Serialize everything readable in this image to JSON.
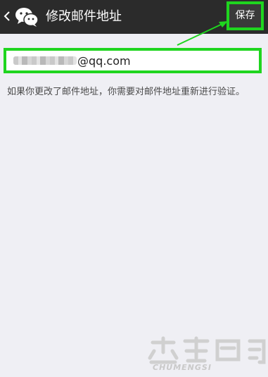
{
  "header": {
    "back_icon": "chevron-left-icon",
    "app_icon": "wechat-icon",
    "title": "修改邮件地址",
    "save_label": "保存"
  },
  "email_form": {
    "username_redacted": true,
    "domain_suffix": "@qq.com",
    "hint": "如果你更改了邮件地址，你需要对邮件地址重新进行验证。"
  },
  "watermark": {
    "caption": "CHUMENGSI"
  },
  "colors": {
    "topbar": "#2b2b2b",
    "background": "#efeff4",
    "highlight": "#1fd51f"
  }
}
